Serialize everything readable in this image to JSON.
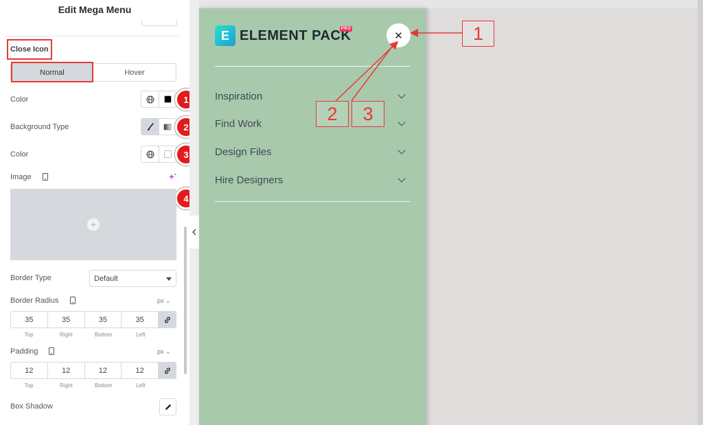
{
  "panel": {
    "title": "Edit Mega Menu",
    "section_label": "Close Icon",
    "tabs": {
      "normal": "Normal",
      "hover": "Hover",
      "active": "normal"
    },
    "color_label": "Color",
    "background_type_label": "Background Type",
    "bg_color_label": "Color",
    "image_label": "Image",
    "border_type_label": "Border Type",
    "border_type_value": "Default",
    "border_radius_label": "Border Radius",
    "border_radius_unit": "px",
    "border_radius": {
      "top": "35",
      "right": "35",
      "bottom": "35",
      "left": "35"
    },
    "padding_label": "Padding",
    "padding_unit": "px",
    "padding": {
      "top": "12",
      "right": "12",
      "bottom": "12",
      "left": "12"
    },
    "side_labels": {
      "top": "Top",
      "right": "Right",
      "bottom": "Bottom",
      "left": "Left"
    },
    "box_shadow_label": "Box Shadow",
    "badges": [
      "1",
      "2",
      "3",
      "4"
    ],
    "swatch_colors": {
      "icon_color": "#000000",
      "bg_color": "#ffffff"
    }
  },
  "menu": {
    "logo_text": "ELEMENT PACK",
    "logo_pro": "PRO",
    "logo_icon_letter": "E",
    "close_icon": "close-icon",
    "items": [
      {
        "label": "Inspiration"
      },
      {
        "label": "Find Work"
      },
      {
        "label": "Design Files"
      },
      {
        "label": "Hire Designers"
      }
    ],
    "background": "#a9c9ac"
  },
  "annotations": {
    "box1": "1",
    "box2": "2",
    "box3": "3"
  }
}
